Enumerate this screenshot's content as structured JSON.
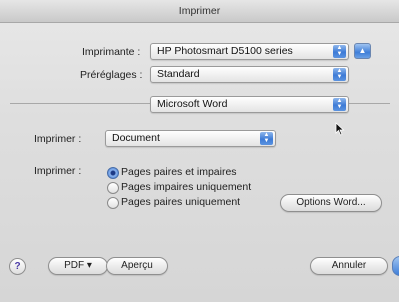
{
  "window": {
    "title": "Imprimer"
  },
  "printer": {
    "label": "Imprimante :",
    "value": "HP Photosmart D5100 series"
  },
  "presets": {
    "label": "Préréglages :",
    "value": "Standard"
  },
  "panel": {
    "value": "Microsoft Word"
  },
  "print_what": {
    "label": "Imprimer :",
    "value": "Document"
  },
  "print_pages": {
    "label": "Imprimer :",
    "options": [
      {
        "label": "Pages paires et impaires",
        "selected": true
      },
      {
        "label": "Pages impaires uniquement",
        "selected": false
      },
      {
        "label": "Pages paires uniquement",
        "selected": false
      }
    ],
    "options_button": "Options Word..."
  },
  "footer": {
    "help": "?",
    "pdf_button": "PDF ▾",
    "preview_button": "Aperçu",
    "cancel_button": "Annuler"
  },
  "icons": {
    "popup_arrows": "updown-arrows-icon",
    "disclosure": "triangle-up-icon",
    "cursor": "mouse-pointer-icon"
  }
}
